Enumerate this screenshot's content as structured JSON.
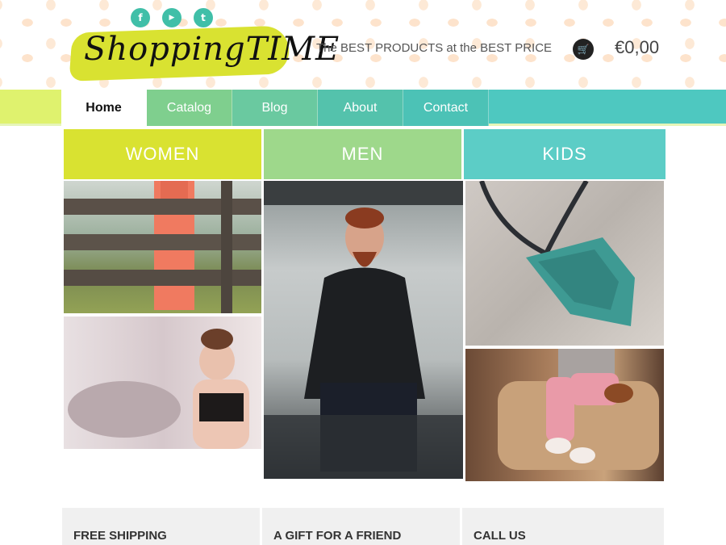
{
  "header": {
    "logo_text": "ShoppingTIME",
    "tagline": "The BEST PRODUCTS at the BEST PRICE",
    "cart_total": "€0,00",
    "social": [
      {
        "icon": "facebook-icon",
        "glyph": "f"
      },
      {
        "icon": "youtube-icon",
        "glyph": "▶"
      },
      {
        "icon": "twitter-icon",
        "glyph": "t"
      }
    ]
  },
  "nav": {
    "items": [
      "Home",
      "Catalog",
      "Blog",
      "About",
      "Contact"
    ],
    "active": "Home"
  },
  "categories": [
    "WOMEN",
    "MEN",
    "KIDS"
  ],
  "features": [
    "FREE SHIPPING",
    "A GIFT FOR A FRIEND",
    "CALL US"
  ],
  "colors": {
    "lime": "#d9e231",
    "green": "#9ed88b",
    "teal": "#5ccdc6",
    "social": "#40bfa8"
  }
}
